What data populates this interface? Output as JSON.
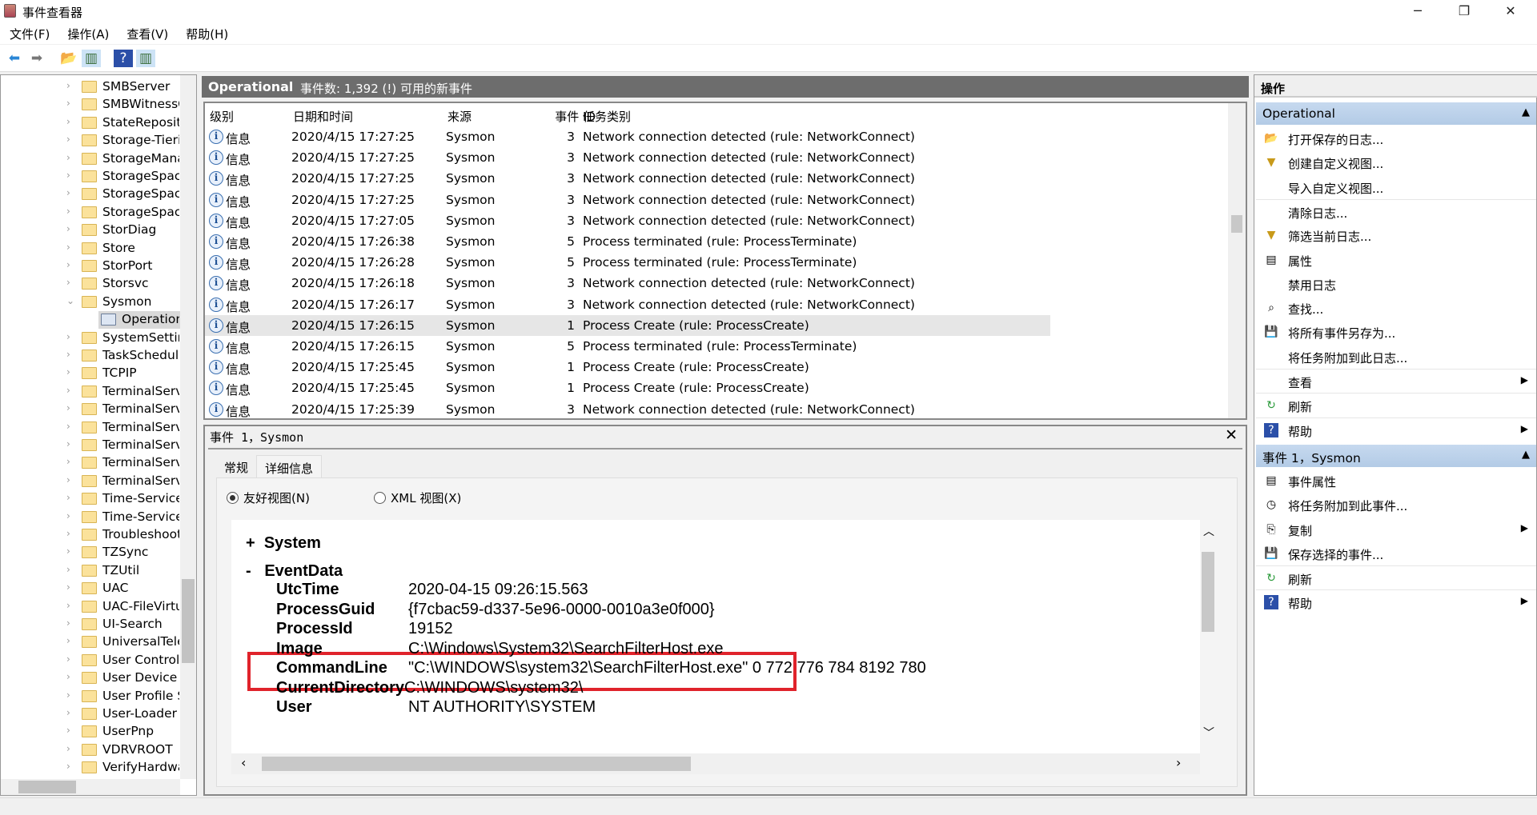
{
  "window": {
    "title": "事件查看器",
    "minimize": "─",
    "maximize": "❐",
    "close": "✕"
  },
  "menu": [
    "文件(F)",
    "操作(A)",
    "查看(V)",
    "帮助(H)"
  ],
  "toolbar": [
    {
      "icon": "back-arrow-icon",
      "glyph": "⬅"
    },
    {
      "icon": "forward-arrow-icon",
      "glyph": "➡"
    },
    {
      "icon": "open-folder-icon",
      "glyph": "📂"
    },
    {
      "icon": "show-hide-console-tree-icon",
      "glyph": "▥"
    },
    {
      "icon": "help-icon",
      "glyph": "?"
    },
    {
      "icon": "show-hide-action-pane-icon",
      "glyph": "▥"
    }
  ],
  "tree": {
    "items": [
      {
        "label": "SMBServer"
      },
      {
        "label": "SMBWitnessC"
      },
      {
        "label": "StateReposito"
      },
      {
        "label": "Storage-Tierir"
      },
      {
        "label": "StorageManag"
      },
      {
        "label": "StorageSpace"
      },
      {
        "label": "StorageSpace"
      },
      {
        "label": "StorageSpace"
      },
      {
        "label": "StorDiag"
      },
      {
        "label": "Store"
      },
      {
        "label": "StorPort"
      },
      {
        "label": "Storsvc"
      },
      {
        "label": "Sysmon",
        "expanded": true
      },
      {
        "label": "Operational",
        "child": true,
        "selected": true
      },
      {
        "label": "SystemSetting"
      },
      {
        "label": "TaskSchedule"
      },
      {
        "label": "TCPIP"
      },
      {
        "label": "TerminalServi"
      },
      {
        "label": "TerminalServi"
      },
      {
        "label": "TerminalServi"
      },
      {
        "label": "TerminalServi"
      },
      {
        "label": "TerminalServi"
      },
      {
        "label": "TerminalServi"
      },
      {
        "label": "Time-Service"
      },
      {
        "label": "Time-Service-"
      },
      {
        "label": "Troubleshooti"
      },
      {
        "label": "TZSync"
      },
      {
        "label": "TZUtil"
      },
      {
        "label": "UAC"
      },
      {
        "label": "UAC-FileVirtu"
      },
      {
        "label": "UI-Search"
      },
      {
        "label": "UniversalTeler"
      },
      {
        "label": "User Control F"
      },
      {
        "label": "User Device R"
      },
      {
        "label": "User Profile Se"
      },
      {
        "label": "User-Loader"
      },
      {
        "label": "UserPnp"
      },
      {
        "label": "VDRVROOT"
      },
      {
        "label": "VerifyHardwar"
      }
    ]
  },
  "log": {
    "name": "Operational",
    "summary": "事件数: 1,392 (!) 可用的新事件",
    "columns": [
      "级别",
      "日期和时间",
      "来源",
      "事件 ID",
      "任务类别"
    ],
    "rows": [
      {
        "level": "信息",
        "time": "2020/4/15 17:27:25",
        "source": "Sysmon",
        "id": "3",
        "task": "Network connection detected (rule: NetworkConnect)"
      },
      {
        "level": "信息",
        "time": "2020/4/15 17:27:25",
        "source": "Sysmon",
        "id": "3",
        "task": "Network connection detected (rule: NetworkConnect)"
      },
      {
        "level": "信息",
        "time": "2020/4/15 17:27:25",
        "source": "Sysmon",
        "id": "3",
        "task": "Network connection detected (rule: NetworkConnect)"
      },
      {
        "level": "信息",
        "time": "2020/4/15 17:27:25",
        "source": "Sysmon",
        "id": "3",
        "task": "Network connection detected (rule: NetworkConnect)"
      },
      {
        "level": "信息",
        "time": "2020/4/15 17:27:05",
        "source": "Sysmon",
        "id": "3",
        "task": "Network connection detected (rule: NetworkConnect)"
      },
      {
        "level": "信息",
        "time": "2020/4/15 17:26:38",
        "source": "Sysmon",
        "id": "5",
        "task": "Process terminated (rule: ProcessTerminate)"
      },
      {
        "level": "信息",
        "time": "2020/4/15 17:26:28",
        "source": "Sysmon",
        "id": "5",
        "task": "Process terminated (rule: ProcessTerminate)"
      },
      {
        "level": "信息",
        "time": "2020/4/15 17:26:18",
        "source": "Sysmon",
        "id": "3",
        "task": "Network connection detected (rule: NetworkConnect)"
      },
      {
        "level": "信息",
        "time": "2020/4/15 17:26:17",
        "source": "Sysmon",
        "id": "3",
        "task": "Network connection detected (rule: NetworkConnect)"
      },
      {
        "level": "信息",
        "time": "2020/4/15 17:26:15",
        "source": "Sysmon",
        "id": "1",
        "task": "Process Create (rule: ProcessCreate)",
        "selected": true
      },
      {
        "level": "信息",
        "time": "2020/4/15 17:26:15",
        "source": "Sysmon",
        "id": "5",
        "task": "Process terminated (rule: ProcessTerminate)"
      },
      {
        "level": "信息",
        "time": "2020/4/15 17:25:45",
        "source": "Sysmon",
        "id": "1",
        "task": "Process Create (rule: ProcessCreate)"
      },
      {
        "level": "信息",
        "time": "2020/4/15 17:25:45",
        "source": "Sysmon",
        "id": "1",
        "task": "Process Create (rule: ProcessCreate)"
      },
      {
        "level": "信息",
        "time": "2020/4/15 17:25:39",
        "source": "Sysmon",
        "id": "3",
        "task": "Network connection detected (rule: NetworkConnect)"
      }
    ]
  },
  "detail": {
    "title": "事件 1，Sysmon",
    "close": "✕",
    "tabs": [
      "常规",
      "详细信息"
    ],
    "active_tab": 1,
    "view_friendly": "友好视图(N)",
    "view_xml": "XML 视图(X)",
    "selected_view": "friendly",
    "system": "System",
    "system_toggle": "+",
    "eventdata": "EventData",
    "eventdata_toggle": "-",
    "fields": [
      {
        "k": "UtcTime",
        "v": "2020-04-15 09:26:15.563"
      },
      {
        "k": "ProcessGuid",
        "v": "{f7cbac59-d337-5e96-0000-0010a3e0f000}"
      },
      {
        "k": "ProcessId",
        "v": "19152"
      },
      {
        "k": "Image",
        "v": "C:\\Windows\\System32\\SearchFilterHost.exe",
        "highlighted": true
      },
      {
        "k": "CommandLine",
        "v": "\"C:\\WINDOWS\\system32\\SearchFilterHost.exe\" 0 772 776 784 8192 780"
      },
      {
        "k": "CurrentDirectory",
        "v": "C:\\WINDOWS\\system32\\"
      },
      {
        "k": "User",
        "v": "NT AUTHORITY\\SYSTEM"
      }
    ],
    "highlight_color": "#e0232b"
  },
  "actions": {
    "title": "操作",
    "groups": [
      {
        "label": "Operational",
        "items": [
          {
            "label": "打开保存的日志...",
            "icon": "open-log-icon",
            "glyph": "📂"
          },
          {
            "label": "创建自定义视图...",
            "icon": "filter-create-icon",
            "glyph": "▼"
          },
          {
            "label": "导入自定义视图...",
            "icon": "",
            "glyph": ""
          },
          {
            "label": "清除日志...",
            "icon": "",
            "glyph": "",
            "div": true
          },
          {
            "label": "筛选当前日志...",
            "icon": "filter-icon",
            "glyph": "▼"
          },
          {
            "label": "属性",
            "icon": "properties-icon",
            "glyph": "▤"
          },
          {
            "label": "禁用日志",
            "icon": "",
            "glyph": ""
          },
          {
            "label": "查找...",
            "icon": "binoculars-icon",
            "glyph": "⌕"
          },
          {
            "label": "将所有事件另存为...",
            "icon": "save-icon",
            "glyph": "💾"
          },
          {
            "label": "将任务附加到此日志...",
            "icon": "",
            "glyph": ""
          },
          {
            "label": "查看",
            "icon": "",
            "glyph": "",
            "submenu": true,
            "div": true
          },
          {
            "label": "刷新",
            "icon": "refresh-icon",
            "glyph": "↻",
            "div": true
          },
          {
            "label": "帮助",
            "icon": "help-icon",
            "glyph": "?",
            "submenu": true,
            "div": true
          }
        ]
      },
      {
        "label": "事件 1，Sysmon",
        "items": [
          {
            "label": "事件属性",
            "icon": "event-properties-icon",
            "glyph": "▤"
          },
          {
            "label": "将任务附加到此事件...",
            "icon": "attach-task-icon",
            "glyph": "◷"
          },
          {
            "label": "复制",
            "icon": "copy-icon",
            "glyph": "⎘",
            "submenu": true
          },
          {
            "label": "保存选择的事件...",
            "icon": "save-icon",
            "glyph": "💾"
          },
          {
            "label": "刷新",
            "icon": "refresh-icon",
            "glyph": "↻",
            "div": true
          },
          {
            "label": "帮助",
            "icon": "help-icon",
            "glyph": "?",
            "submenu": true,
            "div": true
          }
        ]
      }
    ]
  }
}
